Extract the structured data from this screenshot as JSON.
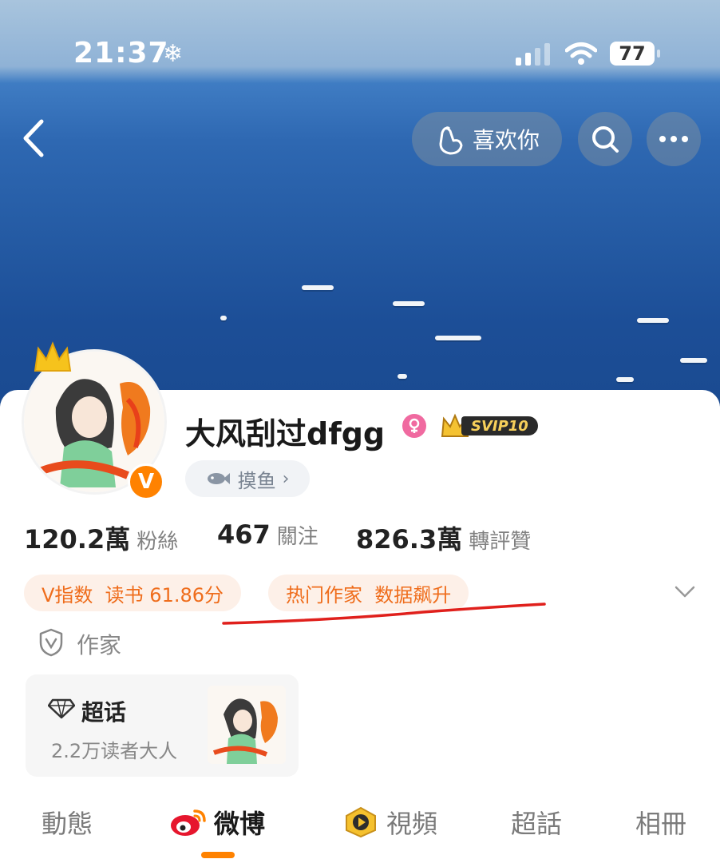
{
  "status_bar": {
    "time": "21:37",
    "battery": "77"
  },
  "header": {
    "like_label": "喜欢你"
  },
  "profile": {
    "username": "大风刮过dfgg",
    "vip_badge": "SVIP10",
    "hobby_tag": "摸鱼",
    "stats": [
      {
        "value": "120.2萬",
        "label": "粉絲"
      },
      {
        "value": "467",
        "label": "關注"
      },
      {
        "value": "826.3萬",
        "label": "轉評贊"
      }
    ],
    "tags": [
      "V指数  读书 61.86分",
      "热门作家  数据飙升"
    ],
    "verified_role": "作家"
  },
  "super_topic": {
    "title": "超话",
    "subtitle": "2.2万读者大人"
  },
  "tabs": [
    {
      "label": "動態",
      "active": false
    },
    {
      "label": "微博",
      "active": true
    },
    {
      "label": "視頻",
      "active": false
    },
    {
      "label": "超話",
      "active": false
    },
    {
      "label": "相冊",
      "active": false
    }
  ],
  "colors": {
    "accent": "#ff8200",
    "tag_text": "#ef6d1c",
    "tag_bg": "#fdf0e8",
    "annotation": "#e0201c"
  }
}
